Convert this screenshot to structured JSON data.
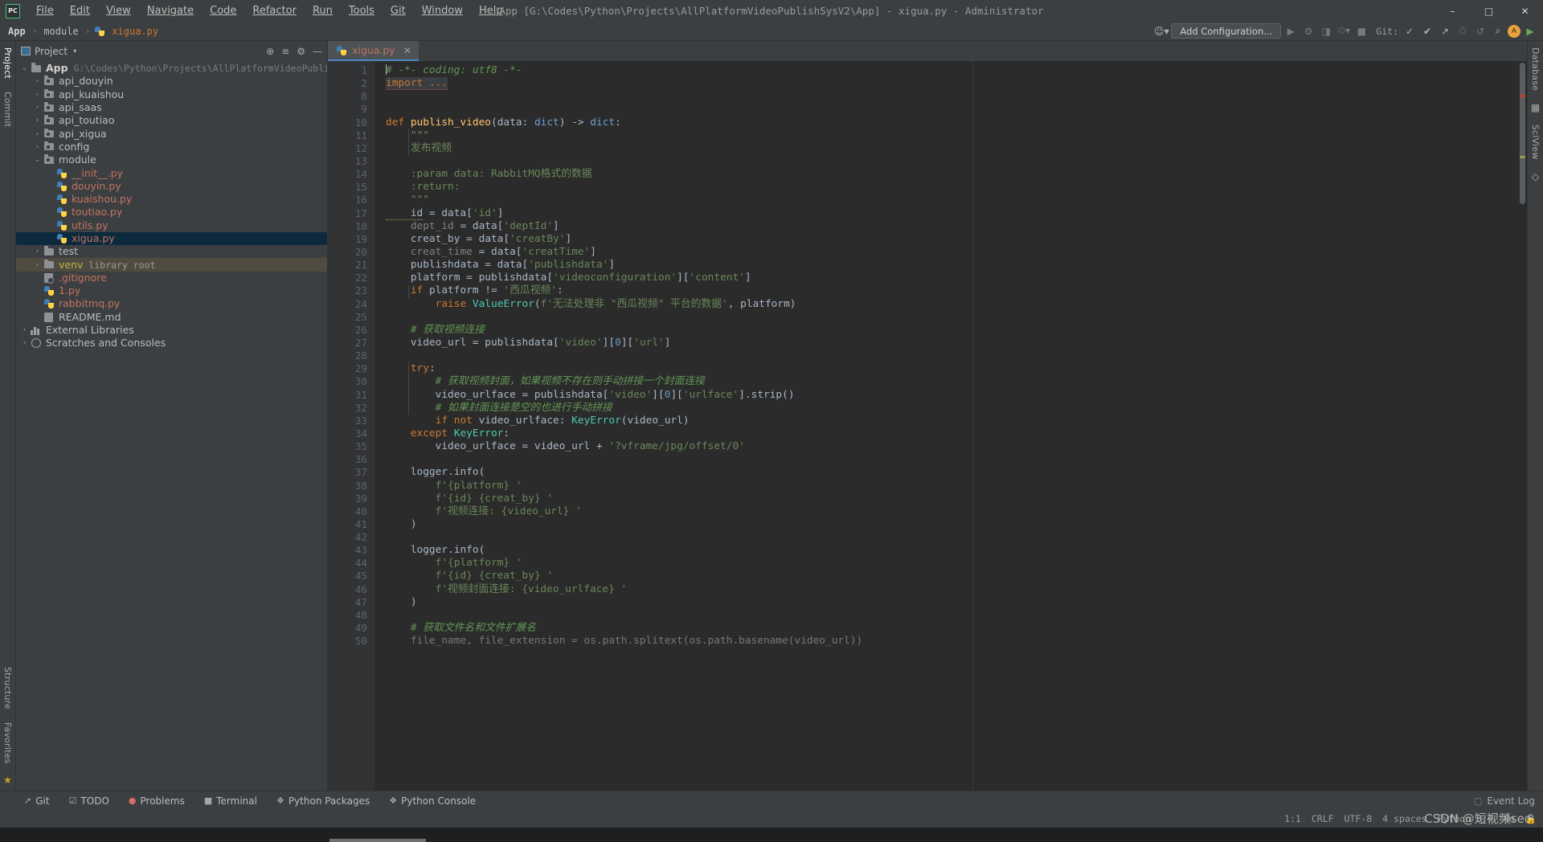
{
  "window": {
    "title": "App [G:\\Codes\\Python\\Projects\\AllPlatformVideoPublishSysV2\\App] - xigua.py - Administrator",
    "logo_line1": "PC",
    "logo_line2": "—",
    "minimize": "–",
    "maximize": "□",
    "close": "✕"
  },
  "menu": {
    "items": [
      {
        "label": "File"
      },
      {
        "label": "Edit"
      },
      {
        "label": "View"
      },
      {
        "label": "Navigate"
      },
      {
        "label": "Code"
      },
      {
        "label": "Refactor"
      },
      {
        "label": "Run"
      },
      {
        "label": "Tools"
      },
      {
        "label": "Git"
      },
      {
        "label": "Window"
      },
      {
        "label": "Help"
      }
    ]
  },
  "navbar": {
    "breadcrumb": [
      "App",
      "module",
      "xigua.py"
    ],
    "separator": "›",
    "profile_icon": "user-icon",
    "add_configuration": "Add Configuration...",
    "run_icon": "▶",
    "debug_icon": "🐞",
    "coverage_icon": "◩",
    "profile_run_icon": "⏱",
    "git_label": "Git:",
    "search_icon": "⌕",
    "settings_icon": "⚙",
    "update_icon": "↻",
    "avatar_letter": "A"
  },
  "left_strip": {
    "tabs": [
      "Project",
      "Commit"
    ],
    "bottom_tabs": [
      "Structure",
      "Favorites"
    ],
    "star_icon": "★"
  },
  "right_strip": {
    "tabs": [
      "Database",
      "SciView"
    ]
  },
  "project_panel": {
    "title": "Project",
    "caret": "▾",
    "locate_icon": "⊕",
    "collapse_icon": "≡",
    "settings_icon": "⚙",
    "hide_icon": "—",
    "tree": [
      {
        "label": "App",
        "sub": "G:\\Codes\\Python\\Projects\\AllPlatformVideoPublishSysV2\\App",
        "indent": 0,
        "icon": "folder",
        "arrow": "⌄",
        "bold": true
      },
      {
        "label": "api_douyin",
        "indent": 1,
        "icon": "module-folder",
        "arrow": "›"
      },
      {
        "label": "api_kuaishou",
        "indent": 1,
        "icon": "module-folder",
        "arrow": "›"
      },
      {
        "label": "api_saas",
        "indent": 1,
        "icon": "module-folder",
        "arrow": "›"
      },
      {
        "label": "api_toutiao",
        "indent": 1,
        "icon": "module-folder",
        "arrow": "›"
      },
      {
        "label": "api_xigua",
        "indent": 1,
        "icon": "module-folder",
        "arrow": "›"
      },
      {
        "label": "config",
        "indent": 1,
        "icon": "module-folder",
        "arrow": "›"
      },
      {
        "label": "module",
        "indent": 1,
        "icon": "module-folder",
        "arrow": "⌄"
      },
      {
        "label": "__init__.py",
        "indent": 2,
        "icon": "python-file",
        "py": true
      },
      {
        "label": "douyin.py",
        "indent": 2,
        "icon": "python-file",
        "py": true
      },
      {
        "label": "kuaishou.py",
        "indent": 2,
        "icon": "python-file",
        "py": true
      },
      {
        "label": "toutiao.py",
        "indent": 2,
        "icon": "python-file",
        "py": true
      },
      {
        "label": "utils.py",
        "indent": 2,
        "icon": "python-file",
        "py": true
      },
      {
        "label": "xigua.py",
        "indent": 2,
        "icon": "python-file",
        "py": true,
        "selected": true
      },
      {
        "label": "test",
        "indent": 1,
        "icon": "folder",
        "arrow": "›"
      },
      {
        "label": "venv",
        "sub": "library root",
        "indent": 1,
        "icon": "folder",
        "arrow": "›",
        "venv": true,
        "hover": true
      },
      {
        "label": ".gitignore",
        "indent": 1,
        "icon": "gitignore-file",
        "py": true
      },
      {
        "label": "1.py",
        "indent": 1,
        "icon": "python-file",
        "py": true
      },
      {
        "label": "rabbitmq.py",
        "indent": 1,
        "icon": "python-file",
        "py": true
      },
      {
        "label": "README.md",
        "indent": 1,
        "icon": "markdown-file"
      },
      {
        "label": "External Libraries",
        "indent": 0,
        "icon": "library",
        "arrow": "›"
      },
      {
        "label": "Scratches and Consoles",
        "indent": 0,
        "icon": "scratch",
        "arrow": "›"
      }
    ]
  },
  "editor": {
    "tab": {
      "name": "xigua.py",
      "close": "✕"
    },
    "first_line": 1,
    "lines": [
      {
        "n": 1,
        "segs": [
          {
            "t": "# -*- coding: utf8 -*-",
            "c": "cmt"
          }
        ],
        "caret": true
      },
      {
        "n": 2,
        "segs": [
          {
            "t": "import ...",
            "c": "kw-import"
          }
        ],
        "fold": "plus",
        "hl": true
      },
      {
        "n": 8,
        "segs": []
      },
      {
        "n": 9,
        "segs": []
      },
      {
        "n": 10,
        "segs": [
          {
            "t": "def ",
            "c": "kw"
          },
          {
            "t": "publish_video",
            "c": "fn"
          },
          {
            "t": "(data: ",
            "c": "param"
          },
          {
            "t": "dict",
            "c": "blue"
          },
          {
            "t": ") -> ",
            "c": "param"
          },
          {
            "t": "dict",
            "c": "blue"
          },
          {
            "t": ":",
            "c": "param"
          }
        ],
        "fold": "minus"
      },
      {
        "n": 11,
        "segs": [
          {
            "t": "    \"\"\"",
            "c": "str"
          }
        ],
        "fold": "minus-small"
      },
      {
        "n": 12,
        "segs": [
          {
            "t": "    发布视频",
            "c": "str"
          }
        ]
      },
      {
        "n": 13,
        "segs": []
      },
      {
        "n": 14,
        "segs": [
          {
            "t": "    :param data: RabbitMQ格式的数据",
            "c": "str"
          }
        ]
      },
      {
        "n": 15,
        "segs": [
          {
            "t": "    :return:",
            "c": "str"
          }
        ]
      },
      {
        "n": 16,
        "segs": [
          {
            "t": "    \"\"\"",
            "c": "str"
          }
        ],
        "fold": "minus-end"
      },
      {
        "n": 17,
        "segs": [
          {
            "t": "    id",
            "c": "squiggle2"
          },
          {
            "t": " = data[",
            "c": "param"
          },
          {
            "t": "'id'",
            "c": "str"
          },
          {
            "t": "]",
            "c": "param"
          }
        ]
      },
      {
        "n": 18,
        "segs": [
          {
            "t": "    dept_id",
            "c": "gray"
          },
          {
            "t": " = data[",
            "c": "param"
          },
          {
            "t": "'deptId'",
            "c": "str"
          },
          {
            "t": "]",
            "c": "param"
          }
        ]
      },
      {
        "n": 19,
        "segs": [
          {
            "t": "    creat_by = data[",
            "c": "param"
          },
          {
            "t": "'creatBy'",
            "c": "str"
          },
          {
            "t": "]",
            "c": "param"
          }
        ]
      },
      {
        "n": 20,
        "segs": [
          {
            "t": "    creat_time",
            "c": "gray"
          },
          {
            "t": " = data[",
            "c": "param"
          },
          {
            "t": "'creatTime'",
            "c": "str"
          },
          {
            "t": "]",
            "c": "param"
          }
        ]
      },
      {
        "n": 21,
        "segs": [
          {
            "t": "    publishdata = data[",
            "c": "param"
          },
          {
            "t": "'publishdata'",
            "c": "str"
          },
          {
            "t": "]",
            "c": "param"
          }
        ]
      },
      {
        "n": 22,
        "segs": [
          {
            "t": "    platform = publishdata[",
            "c": "param"
          },
          {
            "t": "'videoconfiguration'",
            "c": "str"
          },
          {
            "t": "][",
            "c": "param"
          },
          {
            "t": "'content'",
            "c": "str"
          },
          {
            "t": "]",
            "c": "param"
          }
        ]
      },
      {
        "n": 23,
        "segs": [
          {
            "t": "    if",
            "c": "kw"
          },
          {
            "t": " platform != ",
            "c": "param"
          },
          {
            "t": "'西瓜视频'",
            "c": "str"
          },
          {
            "t": ":",
            "c": "param"
          }
        ]
      },
      {
        "n": 24,
        "segs": [
          {
            "t": "        raise ",
            "c": "kw"
          },
          {
            "t": "ValueError",
            "c": "typ"
          },
          {
            "t": "(",
            "c": "param"
          },
          {
            "t": "f'无法处理非 \"西瓜视频\" 平台的数据'",
            "c": "str"
          },
          {
            "t": ", platform)",
            "c": "param"
          }
        ]
      },
      {
        "n": 25,
        "segs": []
      },
      {
        "n": 26,
        "segs": [
          {
            "t": "    # 获取视频连接",
            "c": "cmt"
          }
        ]
      },
      {
        "n": 27,
        "segs": [
          {
            "t": "    video_url = publishdata[",
            "c": "param"
          },
          {
            "t": "'video'",
            "c": "str"
          },
          {
            "t": "][",
            "c": "param"
          },
          {
            "t": "0",
            "c": "num"
          },
          {
            "t": "][",
            "c": "param"
          },
          {
            "t": "'url'",
            "c": "str"
          },
          {
            "t": "]",
            "c": "param"
          }
        ]
      },
      {
        "n": 28,
        "segs": []
      },
      {
        "n": 29,
        "segs": [
          {
            "t": "    try",
            "c": "kw"
          },
          {
            "t": ":",
            "c": "param"
          }
        ],
        "fold": "minus"
      },
      {
        "n": 30,
        "segs": [
          {
            "t": "        # 获取视频封面，如果视频不存在则手动拼接一个封面连接",
            "c": "cmt"
          }
        ]
      },
      {
        "n": 31,
        "segs": [
          {
            "t": "        video_urlface = publishdata[",
            "c": "param"
          },
          {
            "t": "'video'",
            "c": "str"
          },
          {
            "t": "][",
            "c": "param"
          },
          {
            "t": "0",
            "c": "num"
          },
          {
            "t": "][",
            "c": "param"
          },
          {
            "t": "'urlface'",
            "c": "str"
          },
          {
            "t": "].strip()",
            "c": "param"
          }
        ]
      },
      {
        "n": 32,
        "segs": [
          {
            "t": "        # 如果封面连接是空的也进行手动拼接",
            "c": "cmt"
          }
        ]
      },
      {
        "n": 33,
        "segs": [
          {
            "t": "        if not ",
            "c": "kw"
          },
          {
            "t": "video_urlface: ",
            "c": "param"
          },
          {
            "t": "KeyError",
            "c": "typ"
          },
          {
            "t": "(video_url)",
            "c": "param"
          }
        ],
        "fold": "minus-small"
      },
      {
        "n": 34,
        "segs": [
          {
            "t": "    except ",
            "c": "kw"
          },
          {
            "t": "KeyError",
            "c": "typ"
          },
          {
            "t": ":",
            "c": "param"
          }
        ]
      },
      {
        "n": 35,
        "segs": [
          {
            "t": "        video_urlface = video_url + ",
            "c": "param"
          },
          {
            "t": "'?vframe/jpg/offset/0'",
            "c": "str"
          }
        ]
      },
      {
        "n": 36,
        "segs": []
      },
      {
        "n": 37,
        "segs": [
          {
            "t": "    logger.info(",
            "c": "param"
          }
        ]
      },
      {
        "n": 38,
        "segs": [
          {
            "t": "        f'{platform} '",
            "c": "str"
          }
        ],
        "fold": "minus-small"
      },
      {
        "n": 39,
        "segs": [
          {
            "t": "        f'{id} {creat_by} '",
            "c": "str"
          }
        ]
      },
      {
        "n": 40,
        "segs": [
          {
            "t": "        f'视频连接: {video_url} '",
            "c": "str"
          }
        ],
        "fold": "minus-small"
      },
      {
        "n": 41,
        "segs": [
          {
            "t": "    )",
            "c": "param"
          }
        ]
      },
      {
        "n": 42,
        "segs": []
      },
      {
        "n": 43,
        "segs": [
          {
            "t": "    logger.info(",
            "c": "param"
          }
        ]
      },
      {
        "n": 44,
        "segs": [
          {
            "t": "        f'{platform} '",
            "c": "str"
          }
        ],
        "fold": "minus-small"
      },
      {
        "n": 45,
        "segs": [
          {
            "t": "        f'{id} {creat_by} '",
            "c": "str"
          }
        ]
      },
      {
        "n": 46,
        "segs": [
          {
            "t": "        f'视频封面连接: {video_urlface} '",
            "c": "str"
          }
        ],
        "fold": "minus-small"
      },
      {
        "n": 47,
        "segs": [
          {
            "t": "    )",
            "c": "param"
          }
        ]
      },
      {
        "n": 48,
        "segs": []
      },
      {
        "n": 49,
        "segs": [
          {
            "t": "    # 获取文件名和文件扩展名",
            "c": "cmt"
          }
        ]
      },
      {
        "n": 50,
        "segs": [
          {
            "t": "    file_name, file_extension = os.path.splitext(os.path.basename(video_url))",
            "c": "dim"
          }
        ]
      }
    ]
  },
  "bottom_bar": {
    "items": [
      {
        "label": "Git",
        "icon": "git-icon"
      },
      {
        "label": "TODO",
        "icon": "todo-icon"
      },
      {
        "label": "Problems",
        "icon": "problems-icon"
      },
      {
        "label": "Terminal",
        "icon": "terminal-icon"
      },
      {
        "label": "Python Packages",
        "icon": "packages-icon"
      },
      {
        "label": "Python Console",
        "icon": "console-icon"
      }
    ],
    "event_log": "Event Log",
    "event_log_icon": "◌"
  },
  "status_bar": {
    "caret_position": "1:1",
    "line_separator": "CRLF",
    "encoding": "UTF-8",
    "indent": "4 spaces",
    "interpreter": "Python 3.9",
    "branch": "No",
    "lock_icon": "🔒",
    "watermark": "CSDN @短视频seo"
  }
}
